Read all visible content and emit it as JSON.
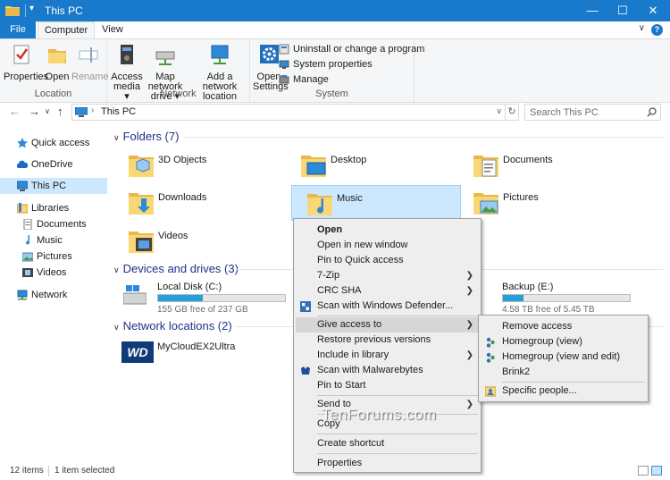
{
  "window": {
    "title": "This PC"
  },
  "ribbon": {
    "tabs": [
      "File",
      "Computer",
      "View"
    ],
    "location": {
      "label": "Location",
      "properties": "Properties",
      "open": "Open",
      "rename": "Rename"
    },
    "network": {
      "label": "Network",
      "access_media_1": "Access",
      "access_media_2": "media ▾",
      "map_drive_1": "Map network",
      "map_drive_2": "drive ▾",
      "add_loc_1": "Add a network",
      "add_loc_2": "location"
    },
    "system": {
      "label": "System",
      "open_settings_1": "Open",
      "open_settings_2": "Settings",
      "uninstall": "Uninstall or change a program",
      "sysprops": "System properties",
      "manage": "Manage"
    }
  },
  "address": {
    "path": "This PC",
    "search_placeholder": "Search This PC"
  },
  "nav": {
    "quick_access": "Quick access",
    "onedrive": "OneDrive",
    "this_pc": "This PC",
    "libraries": "Libraries",
    "documents": "Documents",
    "music": "Music",
    "pictures": "Pictures",
    "videos": "Videos",
    "network": "Network"
  },
  "groups": {
    "folders": "Folders (7)",
    "devices": "Devices and drives (3)",
    "netloc": "Network locations (2)"
  },
  "folders": [
    "3D Objects",
    "Desktop",
    "Documents",
    "Downloads",
    "Music",
    "Pictures",
    "Videos"
  ],
  "drives": {
    "c": {
      "name": "Local Disk (C:)",
      "free": "155 GB free of 237 GB",
      "used_fraction": 0.35
    },
    "e": {
      "name": "Backup (E:)",
      "free": "4.58 TB free of 5.45 TB",
      "used_fraction": 0.16
    }
  },
  "network_locations": [
    "MyCloudEX2Ultra"
  ],
  "nas_logo": "WD",
  "context_menu": {
    "open": "Open",
    "open_new": "Open in new window",
    "pin_qa": "Pin to Quick access",
    "zip": "7-Zip",
    "crc": "CRC SHA",
    "defender": "Scan with Windows Defender...",
    "give_access": "Give access to",
    "restore": "Restore previous versions",
    "include": "Include in library",
    "malwarebytes": "Scan with Malwarebytes",
    "pin_start": "Pin to Start",
    "send_to": "Send to",
    "copy": "Copy",
    "shortcut": "Create shortcut",
    "properties": "Properties"
  },
  "submenu": {
    "remove": "Remove access",
    "hg_view": "Homegroup (view)",
    "hg_edit": "Homegroup (view and edit)",
    "brink": "Brink2",
    "specific": "Specific people..."
  },
  "status": {
    "count": "12 items",
    "selected": "1 item selected"
  },
  "watermark": "TenForums.com",
  "colors": {
    "accent": "#1979ca",
    "selection": "#cce8ff",
    "folder": "#f8d775"
  }
}
